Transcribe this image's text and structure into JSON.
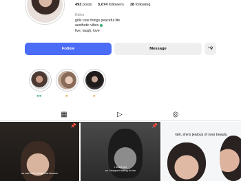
{
  "profile": {
    "stats": {
      "posts_count": "493",
      "posts_label": "posts",
      "followers_count": "5,074",
      "followers_label": "followers",
      "following_count": "38",
      "following_label": "following"
    },
    "category": "Editor",
    "bio_lines": [
      "girls cute things peaceful life",
      "aesthetic vibes",
      "live, laugh, love"
    ],
    "bio_emojis": {
      "line2": "leaf",
      "line3": "♡"
    }
  },
  "actions": {
    "follow_label": "Follow",
    "message_label": "Message",
    "add_icon": "person-add-icon",
    "accent_color": "#4a6cf7"
  },
  "highlights": [
    {
      "label": "●●"
    },
    {
      "label": "●"
    },
    {
      "label": "●"
    }
  ],
  "tabs": [
    {
      "icon": "grid-icon",
      "active": true
    },
    {
      "icon": "reels-icon",
      "active": false
    },
    {
      "icon": "tagged-icon",
      "active": false
    }
  ],
  "posts": [
    {
      "caption": "we had other people that became",
      "pinned": true
    },
    {
      "caption_lines": [
        "I loved him",
        "so I stopped talking to him"
      ],
      "pinned": true
    },
    {
      "caption": "Girl, she's jealous of your beauty.",
      "pinned": false
    }
  ]
}
